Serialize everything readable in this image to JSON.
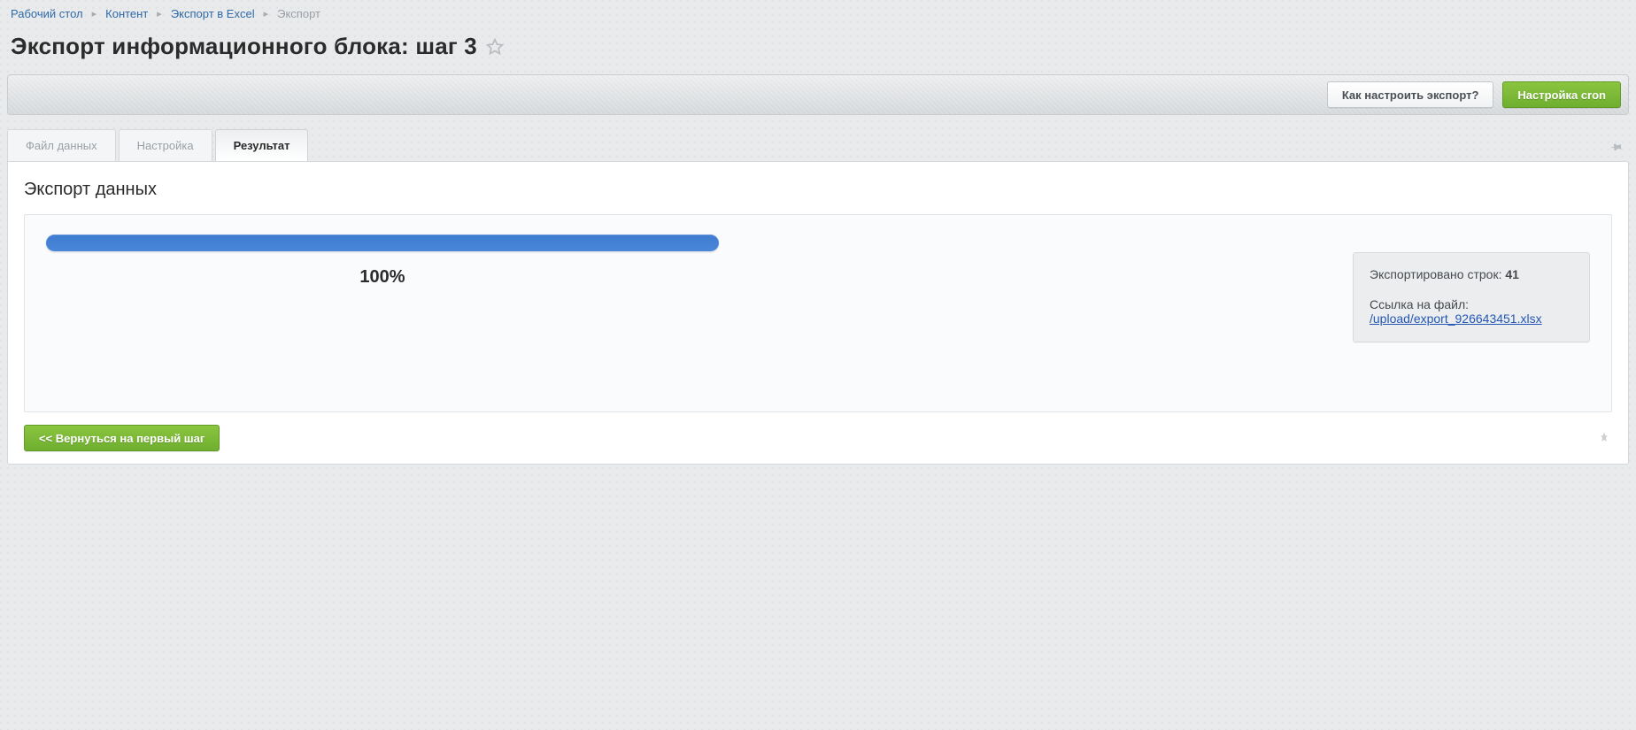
{
  "breadcrumbs": [
    {
      "label": "Рабочий стол",
      "link": true
    },
    {
      "label": "Контент",
      "link": true
    },
    {
      "label": "Экспорт в Excel",
      "link": true
    },
    {
      "label": "Экспорт",
      "link": false
    }
  ],
  "page_title": "Экспорт информационного блока: шаг 3",
  "toolbar": {
    "help_label": "Как настроить экспорт?",
    "cron_label": "Настройка cron"
  },
  "tabs": [
    {
      "label": "Файл данных",
      "active": false
    },
    {
      "label": "Настройка",
      "active": false
    },
    {
      "label": "Результат",
      "active": true
    }
  ],
  "section_title": "Экспорт данных",
  "progress": {
    "percent_text": "100%"
  },
  "result": {
    "rows_label": "Экспортировано строк:",
    "rows_count": "41",
    "file_label": "Ссылка на файл:",
    "file_path": "/upload/export_926643451.xlsx"
  },
  "footer": {
    "back_label": "<< Вернуться на первый шаг"
  }
}
